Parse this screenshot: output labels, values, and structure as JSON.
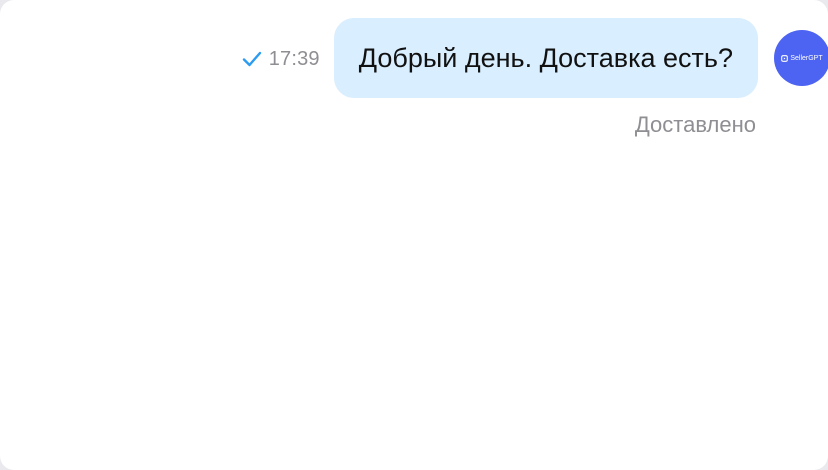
{
  "message": {
    "time": "17:39",
    "text": "Добрый день. Доставка есть?",
    "status": "Доставлено",
    "check_icon": "check-icon"
  },
  "avatar": {
    "brand": "SellerGPT",
    "color": "#4d63f2"
  },
  "colors": {
    "bubble": "#d9eefe",
    "check": "#2d9cf0",
    "meta_text": "#8e8e93"
  }
}
